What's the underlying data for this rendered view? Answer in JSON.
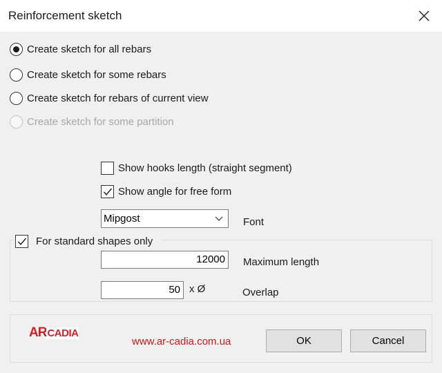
{
  "window": {
    "title": "Reinforcement sketch",
    "close_icon": "close-icon"
  },
  "sketch_mode": {
    "options": [
      {
        "label": "Create sketch for all rebars",
        "checked": true,
        "enabled": true
      },
      {
        "label": "Create sketch for some rebars",
        "checked": false,
        "enabled": true
      },
      {
        "label": "Create sketch for rebars of current view",
        "checked": false,
        "enabled": true
      },
      {
        "label": "Create sketch for some partition",
        "checked": false,
        "enabled": false
      }
    ]
  },
  "options": {
    "show_hooks": {
      "label": "Show hooks length (straight segment)",
      "checked": false
    },
    "show_angle": {
      "label": "Show angle for free form",
      "checked": true
    }
  },
  "font": {
    "selected": "Mipgost",
    "label": "Font"
  },
  "standard_shapes": {
    "label": "For standard shapes only",
    "checked": true,
    "max_length": {
      "value": "12000",
      "label": "Maximum length"
    },
    "overlap": {
      "value": "50",
      "unit": "x Ø",
      "label": "Overlap"
    }
  },
  "footer": {
    "logo_ar": "AR",
    "logo_cadia": "CADIA",
    "website": "www.ar-cadia.com.ua",
    "ok_label": "OK",
    "cancel_label": "Cancel"
  },
  "colors": {
    "brand": "#d01f28",
    "dialog_bg": "#f0f0f0",
    "button_bg": "#e1e1e1"
  }
}
